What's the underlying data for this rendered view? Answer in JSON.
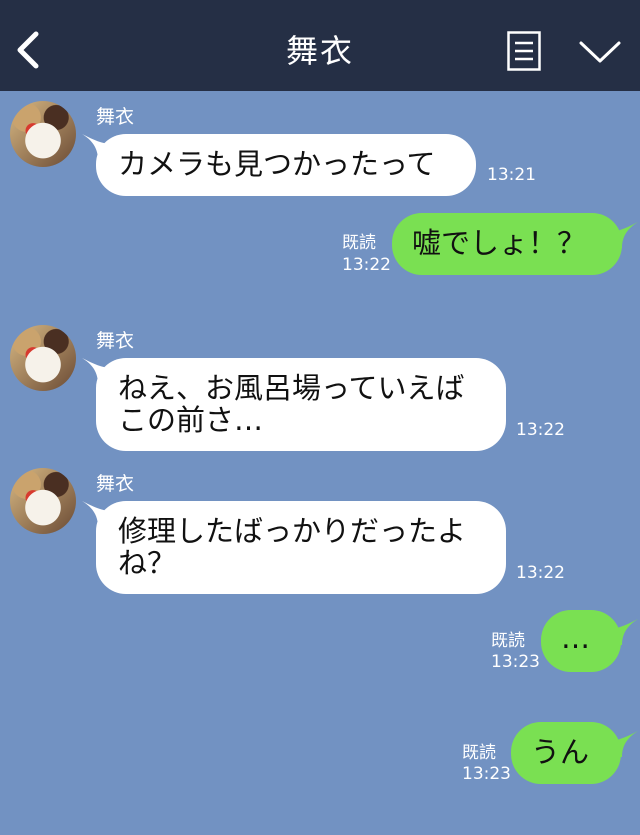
{
  "header": {
    "title": "舞衣"
  },
  "messages": [
    {
      "sender": "舞衣",
      "text": "カメラも見つかったって",
      "time": "13:21"
    },
    {
      "read": "既読",
      "text": "嘘でしょ！？",
      "time": "13:22"
    },
    {
      "sender": "舞衣",
      "text": "ねえ、お風呂場っていえば\nこの前さ…",
      "time": "13:22"
    },
    {
      "sender": "舞衣",
      "text": "修理したばっかりだったよ\nね？",
      "time": "13:22"
    },
    {
      "read": "既読",
      "text": "…",
      "time": "13:23"
    },
    {
      "read": "既読",
      "text": "うん",
      "time": "13:23"
    }
  ],
  "icons": [
    "back-icon",
    "menu-icon",
    "chevron-down-icon"
  ]
}
